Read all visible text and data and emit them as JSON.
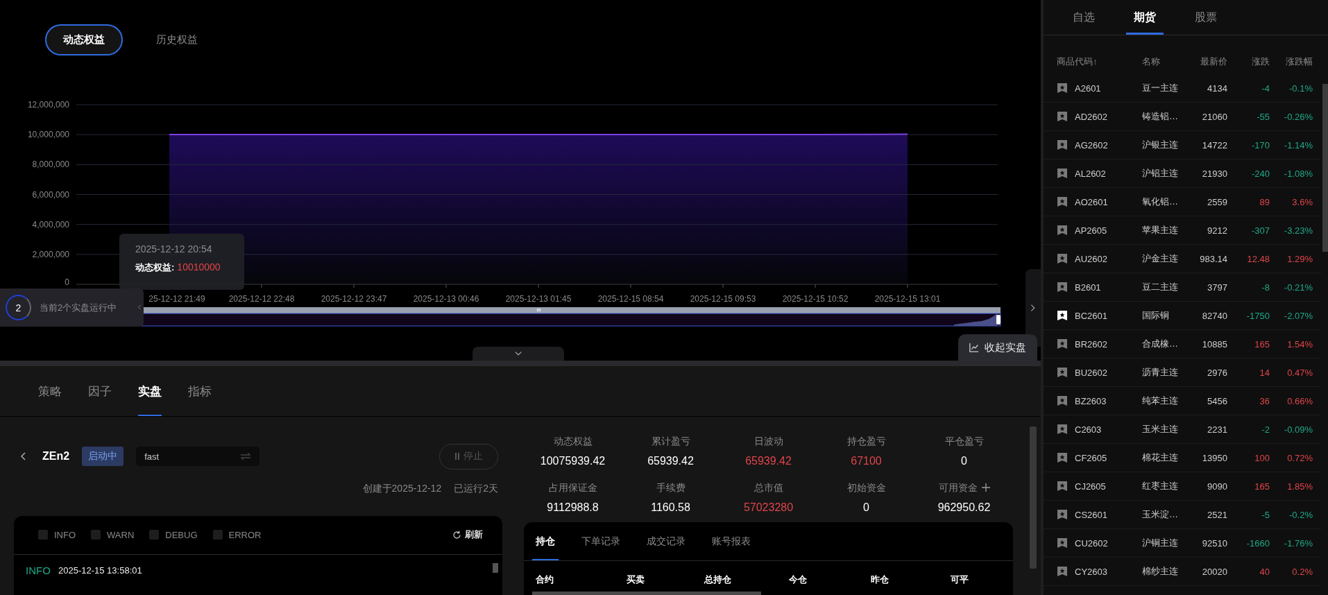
{
  "equity_tabs": [
    {
      "label": "动态权益",
      "selected": true
    },
    {
      "label": "历史权益",
      "selected": false
    }
  ],
  "equity_chart": {
    "chart_data": {
      "type": "area",
      "categories": [
        "25-12-12 21:49",
        "2025-12-12 22:48",
        "2025-12-12 23:47",
        "2025-12-13 00:46",
        "2025-12-13 01:45",
        "2025-12-15 08:54",
        "2025-12-15 09:53",
        "2025-12-15 10:52",
        "2025-12-15 13:01"
      ],
      "series": [
        {
          "color": "#7b3fe4",
          "values": [
            10010000,
            10010000,
            10010000,
            10010000,
            10010000,
            10010000,
            10010000,
            10010000,
            10030000
          ]
        }
      ],
      "ylim": [
        0,
        12000000
      ],
      "grid": true,
      "yticks": [
        {
          "value": 0,
          "label": "0"
        },
        {
          "value": 2000000,
          "label": "2,000,000"
        },
        {
          "value": 4000000,
          "label": "4,000,000"
        },
        {
          "value": 6000000,
          "label": "6,000,000"
        },
        {
          "value": 8000000,
          "label": "8,000,000"
        },
        {
          "value": 10000000,
          "label": "10,000,000"
        },
        {
          "value": 12000000,
          "label": "12,000,000"
        }
      ]
    },
    "tooltip": {
      "time": "2025-12-12 20:54",
      "label": "动态权益:",
      "value": "10010000"
    }
  },
  "running_status": {
    "count": "2",
    "text": "当前2个实盘运行中"
  },
  "collapse_button": "收起实盘",
  "section_tabs": [
    {
      "label": "策略",
      "selected": false
    },
    {
      "label": "因子",
      "selected": false
    },
    {
      "label": "实盘",
      "selected": true
    },
    {
      "label": "指标",
      "selected": false
    }
  ],
  "strategy": {
    "name": "ZEn2",
    "status": "启动中",
    "mode": "fast",
    "stop_label": "停止",
    "created": "创建于2025-12-12",
    "running": "已运行2天"
  },
  "log": {
    "filters": [
      {
        "label": "INFO",
        "checked": false
      },
      {
        "label": "WARN",
        "checked": false
      },
      {
        "label": "DEBUG",
        "checked": false
      },
      {
        "label": "ERROR",
        "checked": false
      }
    ],
    "refresh": "刷新",
    "entries": [
      {
        "level": "INFO",
        "color": "#1fa889",
        "time": "2025-12-15 13:58:01"
      }
    ]
  },
  "stats": [
    {
      "label": "动态权益",
      "value": "10075939.42",
      "color": "#ffffff",
      "kind": "plain"
    },
    {
      "label": "累计盈亏",
      "value": "65939.42",
      "color": "#ffffff",
      "kind": "plain"
    },
    {
      "label": "日波动",
      "value": "65939.42",
      "color": "#e0454b",
      "kind": "plain"
    },
    {
      "label": "持仓盈亏",
      "value": "67100",
      "color": "#e0454b",
      "kind": "plain"
    },
    {
      "label": "平仓盈亏",
      "value": "0",
      "color": "#ffffff",
      "kind": "plain"
    },
    {
      "label": "占用保证金",
      "value": "9112988.8",
      "color": "#ffffff",
      "kind": "plain"
    },
    {
      "label": "手续费",
      "value": "1160.58",
      "color": "#ffffff",
      "kind": "plain"
    },
    {
      "label": "总市值",
      "value": "57023280",
      "color": "#e0454b",
      "kind": "plain"
    },
    {
      "label": "初始资金",
      "value": "0",
      "color": "#ffffff",
      "kind": "plain"
    },
    {
      "label": "可用资金",
      "value": "962950.62",
      "color": "#ffffff",
      "kind": "addable"
    }
  ],
  "positions": {
    "tabs": [
      {
        "label": "持仓",
        "selected": true
      },
      {
        "label": "下单记录",
        "selected": false
      },
      {
        "label": "成交记录",
        "selected": false
      },
      {
        "label": "账号报表",
        "selected": false
      }
    ],
    "columns": [
      "合约",
      "买卖",
      "总持仓",
      "今仓",
      "昨仓",
      "可平"
    ]
  },
  "market": {
    "tabs": [
      {
        "label": "自选",
        "selected": false
      },
      {
        "label": "期货",
        "selected": true
      },
      {
        "label": "股票",
        "selected": false
      }
    ],
    "columns": [
      "商品代码↑",
      "名称",
      "最新价",
      "涨跌",
      "涨跌幅"
    ],
    "rows": [
      {
        "code": "A2601",
        "name": "豆一主连",
        "price": "4134",
        "change": "-4",
        "pct": "-0.1%",
        "color": "#1fa889",
        "favorite": false
      },
      {
        "code": "AD2602",
        "name": "铸造铝…",
        "price": "21060",
        "change": "-55",
        "pct": "-0.26%",
        "color": "#1fa889",
        "favorite": false
      },
      {
        "code": "AG2602",
        "name": "沪银主连",
        "price": "14722",
        "change": "-170",
        "pct": "-1.14%",
        "color": "#1fa889",
        "favorite": false
      },
      {
        "code": "AL2602",
        "name": "沪铝主连",
        "price": "21930",
        "change": "-240",
        "pct": "-1.08%",
        "color": "#1fa889",
        "favorite": false
      },
      {
        "code": "AO2601",
        "name": "氧化铝…",
        "price": "2559",
        "change": "89",
        "pct": "3.6%",
        "color": "#e0454b",
        "favorite": false
      },
      {
        "code": "AP2605",
        "name": "苹果主连",
        "price": "9212",
        "change": "-307",
        "pct": "-3.23%",
        "color": "#1fa889",
        "favorite": false
      },
      {
        "code": "AU2602",
        "name": "沪金主连",
        "price": "983.14",
        "change": "12.48",
        "pct": "1.29%",
        "color": "#e0454b",
        "favorite": false
      },
      {
        "code": "B2601",
        "name": "豆二主连",
        "price": "3797",
        "change": "-8",
        "pct": "-0.21%",
        "color": "#1fa889",
        "favorite": false
      },
      {
        "code": "BC2601",
        "name": "国际铜",
        "price": "82740",
        "change": "-1750",
        "pct": "-2.07%",
        "color": "#1fa889",
        "favorite": true
      },
      {
        "code": "BR2602",
        "name": "合成橡…",
        "price": "10885",
        "change": "165",
        "pct": "1.54%",
        "color": "#e0454b",
        "favorite": false
      },
      {
        "code": "BU2602",
        "name": "沥青主连",
        "price": "2976",
        "change": "14",
        "pct": "0.47%",
        "color": "#e0454b",
        "favorite": false
      },
      {
        "code": "BZ2603",
        "name": "纯苯主连",
        "price": "5456",
        "change": "36",
        "pct": "0.66%",
        "color": "#e0454b",
        "favorite": false
      },
      {
        "code": "C2603",
        "name": "玉米主连",
        "price": "2231",
        "change": "-2",
        "pct": "-0.09%",
        "color": "#1fa889",
        "favorite": false
      },
      {
        "code": "CF2605",
        "name": "棉花主连",
        "price": "13950",
        "change": "100",
        "pct": "0.72%",
        "color": "#e0454b",
        "favorite": false
      },
      {
        "code": "CJ2605",
        "name": "红枣主连",
        "price": "9090",
        "change": "165",
        "pct": "1.85%",
        "color": "#e0454b",
        "favorite": false
      },
      {
        "code": "CS2601",
        "name": "玉米淀…",
        "price": "2521",
        "change": "-5",
        "pct": "-0.2%",
        "color": "#1fa889",
        "favorite": false
      },
      {
        "code": "CU2602",
        "name": "沪铜主连",
        "price": "92510",
        "change": "-1660",
        "pct": "-1.76%",
        "color": "#1fa889",
        "favorite": false
      },
      {
        "code": "CY2603",
        "name": "棉纱主连",
        "price": "20020",
        "change": "40",
        "pct": "0.2%",
        "color": "#e0454b",
        "favorite": false
      }
    ]
  }
}
